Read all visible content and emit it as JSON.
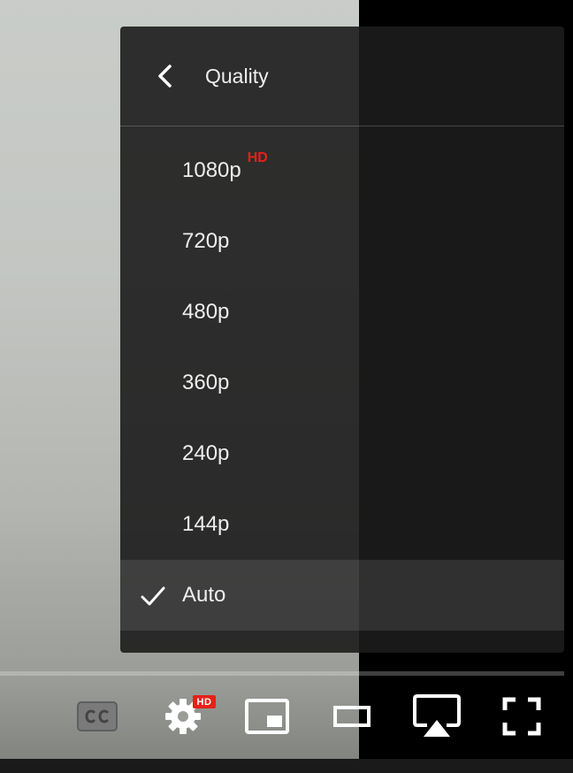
{
  "menu": {
    "title": "Quality",
    "items": [
      {
        "label": "1080p",
        "badge": "HD"
      },
      {
        "label": "720p"
      },
      {
        "label": "480p"
      },
      {
        "label": "360p"
      },
      {
        "label": "240p"
      },
      {
        "label": "144p"
      },
      {
        "label": "Auto",
        "selected": true
      }
    ]
  },
  "controls": {
    "settings_badge": "HD",
    "icons": [
      "subtitles-icon",
      "settings-gear-icon",
      "miniplayer-icon",
      "theater-mode-icon",
      "airplay-icon",
      "fullscreen-icon"
    ]
  },
  "colors": {
    "accent_red": "#e62117",
    "menu_bg": "#1c1c1c",
    "text": "#eeeeee"
  }
}
